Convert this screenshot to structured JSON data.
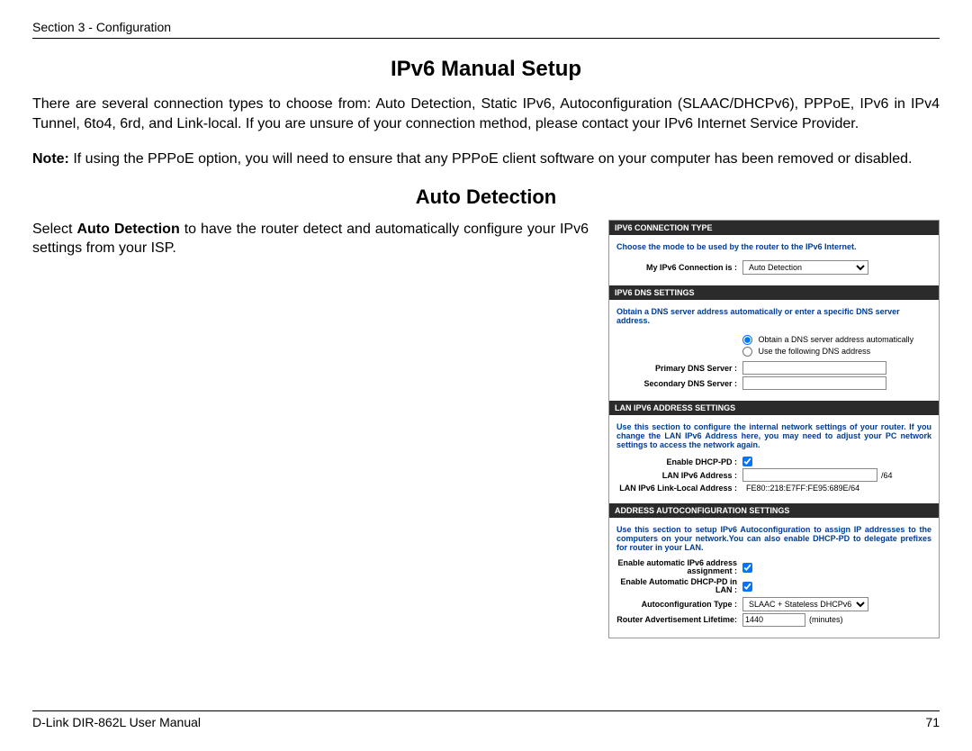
{
  "header": {
    "section": "Section 3 - Configuration"
  },
  "title": "IPv6 Manual Setup",
  "intro": "There are several connection types to choose from: Auto Detection, Static IPv6, Autoconfiguration (SLAAC/DHCPv6), PPPoE, IPv6 in IPv4 Tunnel, 6to4, 6rd, and Link-local. If you are unsure of your connection method, please contact your IPv6 Internet Service Provider.",
  "note_label": "Note:",
  "note_text": " If using the PPPoE option, you will need to ensure that any PPPoE client software on your computer has been removed or disabled.",
  "subhead": "Auto Detection",
  "auto_desc_pre": "Select ",
  "auto_desc_bold": "Auto Detection",
  "auto_desc_post": " to have the router detect and automatically configure your IPv6 settings from your ISP.",
  "panel": {
    "conn_type": {
      "hdr": "IPv6 CONNECTION TYPE",
      "desc": "Choose the mode to be used by the router to the IPv6 Internet.",
      "label": "My IPv6 Connection is :",
      "value": "Auto Detection"
    },
    "dns": {
      "hdr": "IPv6 DNS SETTINGS",
      "desc": "Obtain a DNS server address automatically or enter a specific DNS server address.",
      "radio1": "Obtain a DNS server address automatically",
      "radio2": "Use the following DNS address",
      "primary_label": "Primary DNS Server :",
      "secondary_label": "Secondary DNS Server :"
    },
    "lan": {
      "hdr": "LAN IPv6 ADDRESS SETTINGS",
      "desc": "Use this section to configure the internal network settings of your router. If you change the LAN IPv6 Address here, you may need to adjust your PC network settings to access the network again.",
      "dhcp_label": "Enable DHCP-PD :",
      "addr_label": "LAN IPv6 Address :",
      "suffix": "/64",
      "ll_label": "LAN IPv6 Link-Local Address :",
      "ll_value": "FE80::218:E7FF:FE95:689E/64"
    },
    "autoconf": {
      "hdr": "ADDRESS AUTOCONFIGURATION SETTINGS",
      "desc": "Use this section to setup IPv6 Autoconfiguration to assign IP addresses to the computers on your network.You can also enable DHCP-PD to delegate prefixes for router in your LAN.",
      "enable_auto_label": "Enable automatic IPv6 address assignment :",
      "enable_dhcp_label": "Enable Automatic DHCP-PD in LAN :",
      "type_label": "Autoconfiguration Type :",
      "type_value": "SLAAC + Stateless DHCPv6",
      "lifetime_label": "Router Advertisement Lifetime:",
      "lifetime_value": "1440",
      "lifetime_unit": "(minutes)"
    }
  },
  "footer": {
    "manual": "D-Link DIR-862L User Manual",
    "page": "71"
  }
}
